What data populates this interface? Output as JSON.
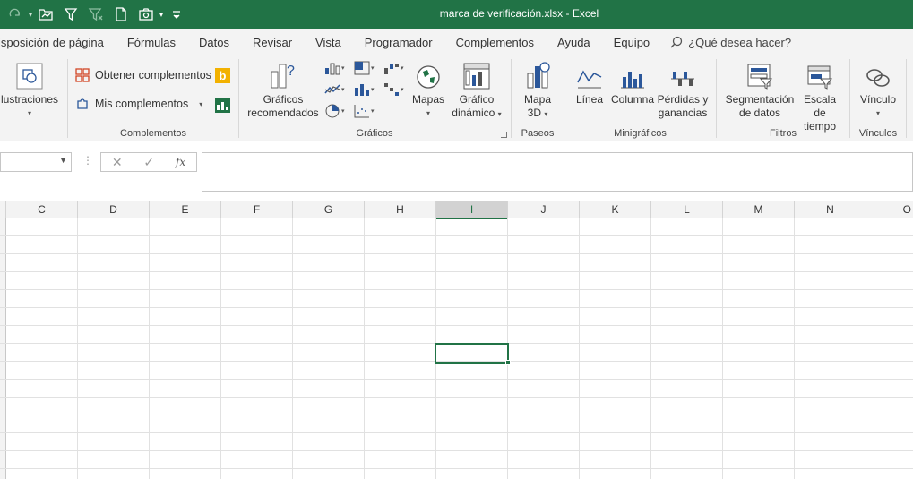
{
  "window": {
    "title": "marca de verificación.xlsx  -  Excel"
  },
  "quick_access": [
    "redo-icon",
    "open-icon",
    "filter-icon",
    "clear-filter-icon",
    "new-icon",
    "camera-icon",
    "customize-icon"
  ],
  "tabs": [
    "isposición de página",
    "Fórmulas",
    "Datos",
    "Revisar",
    "Vista",
    "Programador",
    "Complementos",
    "Ayuda",
    "Equipo"
  ],
  "tell_me": "¿Qué desea hacer?",
  "ribbon": {
    "ilustraciones": "lustraciones",
    "obtener": "Obtener complementos",
    "mis": "Mis complementos",
    "complementos_group": "Complementos",
    "graficos_recomendados_1": "Gráficos",
    "graficos_recomendados_2": "recomendados",
    "mapas": "Mapas",
    "grafico_dinamico_1": "Gráfico",
    "grafico_dinamico_2": "dinámico",
    "graficos_group": "Gráficos",
    "mapa3d_1": "Mapa",
    "mapa3d_2": "3D",
    "paseos_group": "Paseos",
    "linea": "Línea",
    "columna": "Columna",
    "perdidas_1": "Pérdidas y",
    "perdidas_2": "ganancias",
    "minigraficos_group": "Minigráficos",
    "segmentacion_1": "Segmentación",
    "segmentacion_2": "de datos",
    "escala_1": "Escala de",
    "escala_2": "tiempo",
    "filtros_group": "Filtros",
    "vinculo": "Vínculo",
    "vinculos_group": "Vínculos"
  },
  "formula_bar": {
    "name_box": "",
    "cancel": "✕",
    "enter": "✓",
    "fx": "fx",
    "formula": ""
  },
  "columns": [
    "C",
    "D",
    "E",
    "F",
    "G",
    "H",
    "I",
    "J",
    "K",
    "L",
    "M",
    "N",
    "O"
  ],
  "selected_column": "I",
  "colors": {
    "accent": "#217346",
    "ribbon_bg": "#f3f3f3",
    "grid_line": "#e1e1e1"
  }
}
